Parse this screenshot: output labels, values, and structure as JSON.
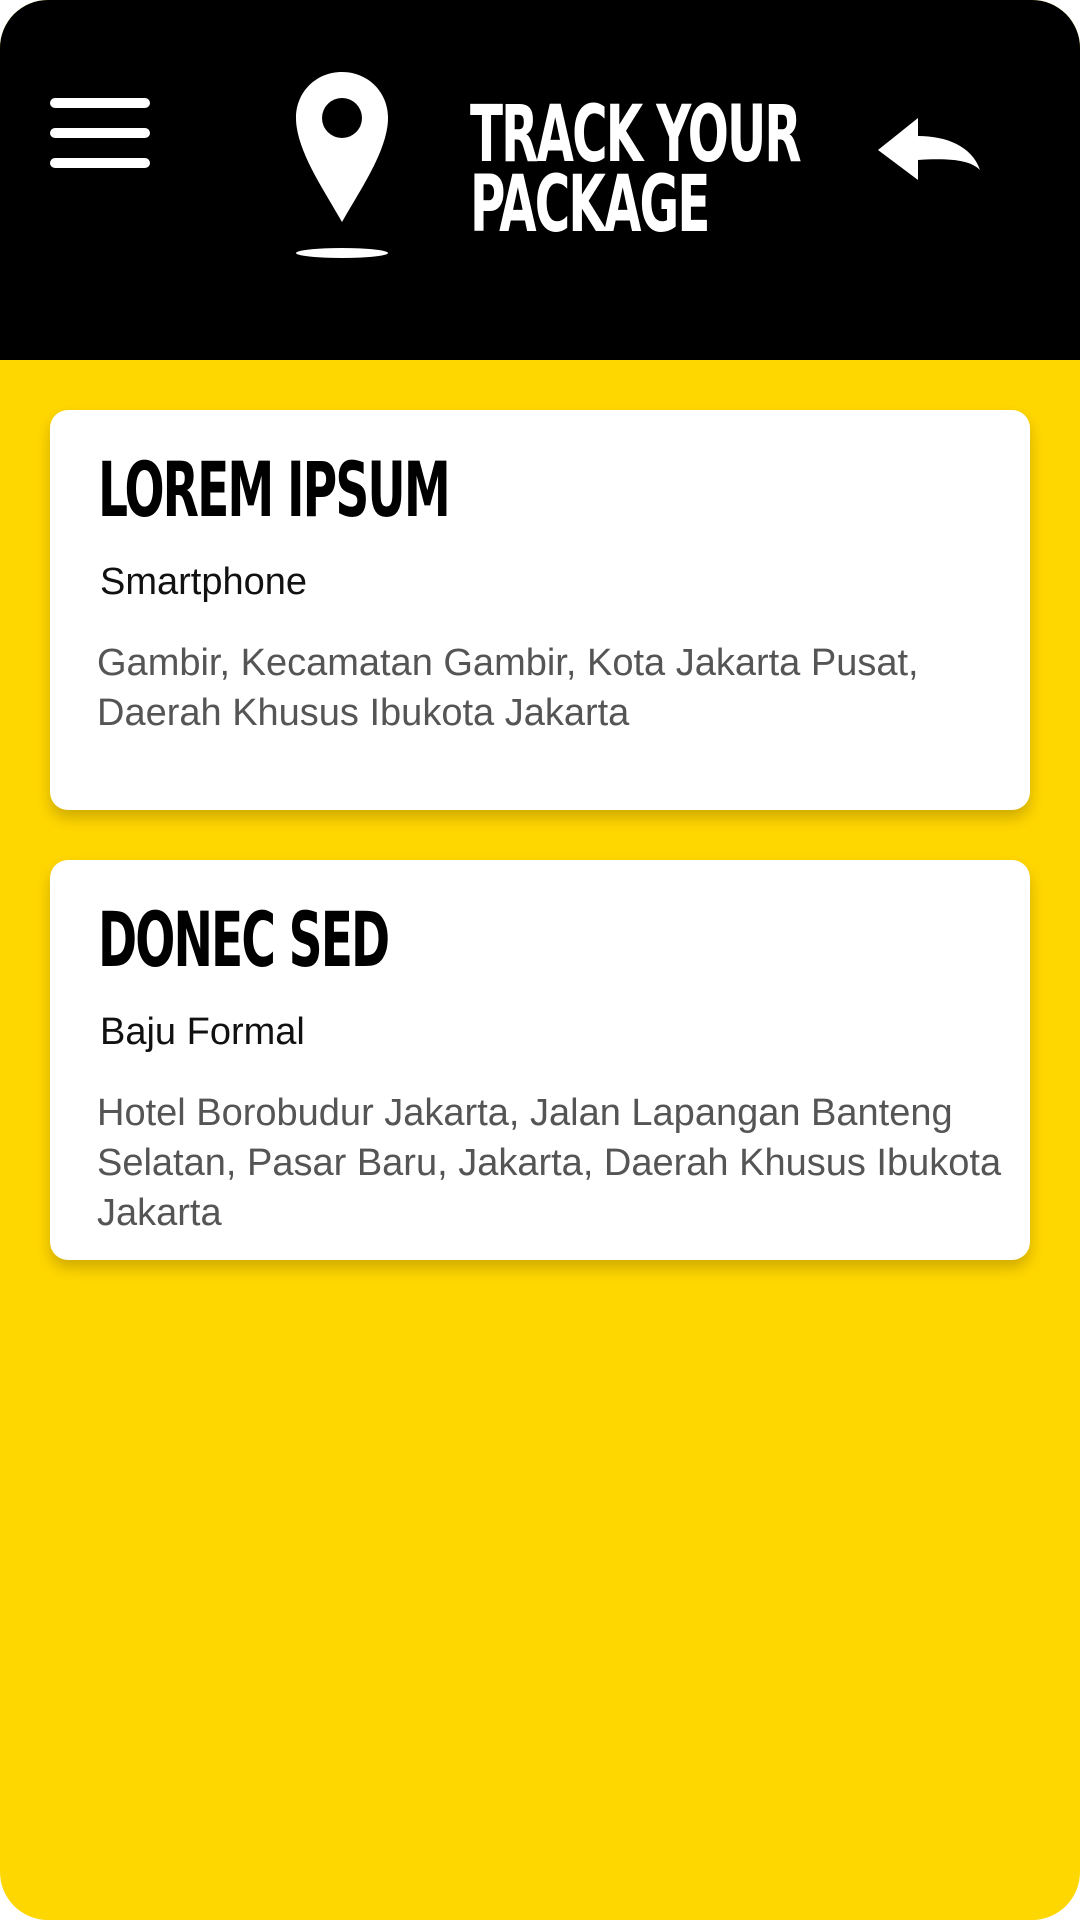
{
  "header": {
    "title": "TRACK YOUR PACKAGE",
    "title_line1": "TRACK YOUR",
    "title_line2": "PACKAGE",
    "icons": {
      "menu": "hamburger-menu-icon",
      "location": "location-pin-icon",
      "back": "back-arrow-icon"
    }
  },
  "packages": [
    {
      "name": "LOREM IPSUM",
      "item": "Smartphone",
      "address": "Gambir, Kecamatan Gambir, Kota Jakarta Pusat, Daerah Khusus Ibukota Jakarta"
    },
    {
      "name": "DONEC SED",
      "item": "Baju Formal",
      "address": "Hotel Borobudur Jakarta, Jalan Lapangan Banteng Selatan, Pasar Baru, Jakarta, Daerah Khusus Ibukota Jakarta"
    }
  ],
  "colors": {
    "header_background": "#000000",
    "page_background": "#FFD700",
    "card_background": "#FFFFFF",
    "address_text": "#555555"
  }
}
